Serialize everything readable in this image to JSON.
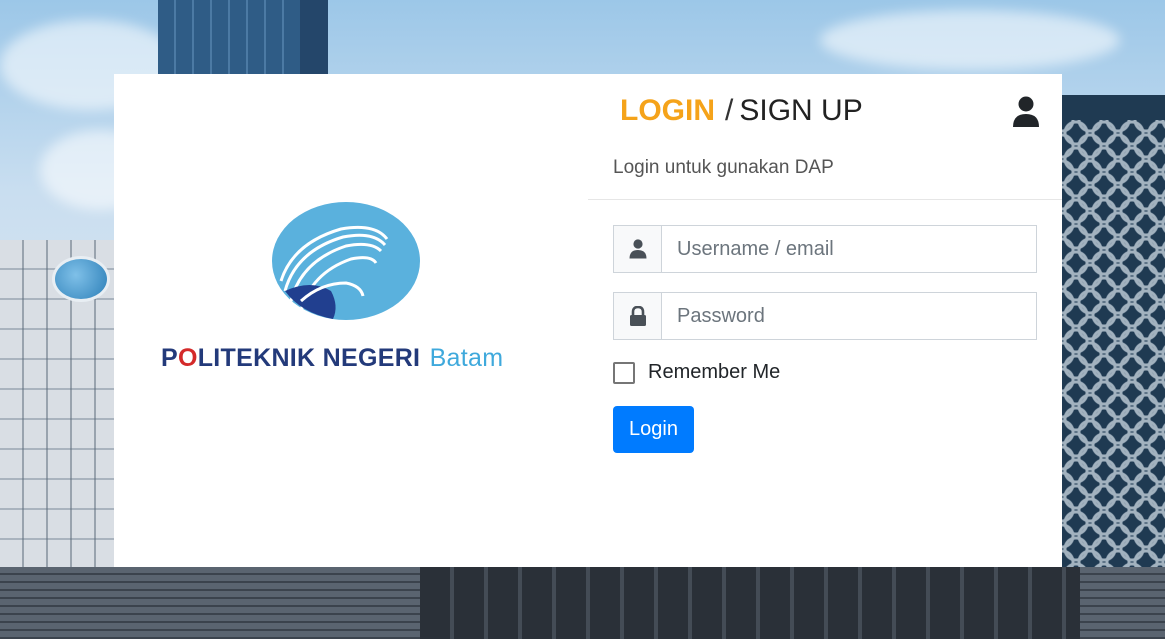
{
  "brand": {
    "name_part1": "P",
    "name_red": "O",
    "name_part2": "LITEKNIK NEGERI",
    "name_city": "Batam"
  },
  "header": {
    "tab_login": "LOGIN",
    "tab_separator": "/",
    "tab_signup": "SIGN UP",
    "subtitle": "Login untuk gunakan DAP"
  },
  "form": {
    "username_placeholder": "Username / email",
    "username_value": "",
    "password_placeholder": "Password",
    "password_value": "",
    "remember_label": "Remember Me",
    "remember_checked": false,
    "submit_label": "Login"
  },
  "icons": {
    "account": "user-icon",
    "username": "user-icon",
    "password": "lock-icon"
  },
  "colors": {
    "accent": "#f5a31a",
    "primary_button": "#007bff",
    "logo_navy": "#233a7a",
    "logo_red": "#d42a2a",
    "logo_blue": "#3fa9dc"
  }
}
